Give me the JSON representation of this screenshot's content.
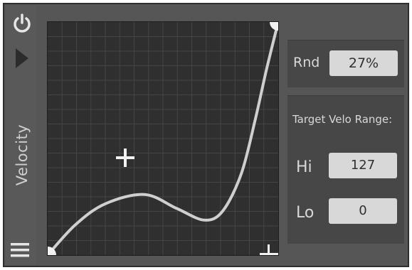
{
  "module": {
    "label": "Velocity"
  },
  "icons": {
    "power": "power-icon",
    "play": "play-triangle-icon",
    "menu": "hamburger-menu-icon",
    "add": "plus-icon"
  },
  "randomize": {
    "label": "Rnd",
    "value": "27%"
  },
  "range": {
    "title": "Target Velo Range:",
    "hi_label": "Hi",
    "hi_value": "127",
    "lo_label": "Lo",
    "lo_value": "0"
  },
  "curve": {
    "x": [
      0,
      0.12,
      0.25,
      0.42,
      0.56,
      0.68,
      0.76,
      0.84,
      0.9,
      0.95,
      1.0
    ],
    "y": [
      0,
      0.13,
      0.22,
      0.26,
      0.2,
      0.15,
      0.19,
      0.35,
      0.58,
      0.8,
      1.0
    ]
  },
  "colors": {
    "background": "#565656",
    "graph_bg": "#2f2f2f",
    "grid": "#454545",
    "curve": "#cfcfcf",
    "label": "#d8d8d8",
    "field": "#d8d8d8"
  }
}
